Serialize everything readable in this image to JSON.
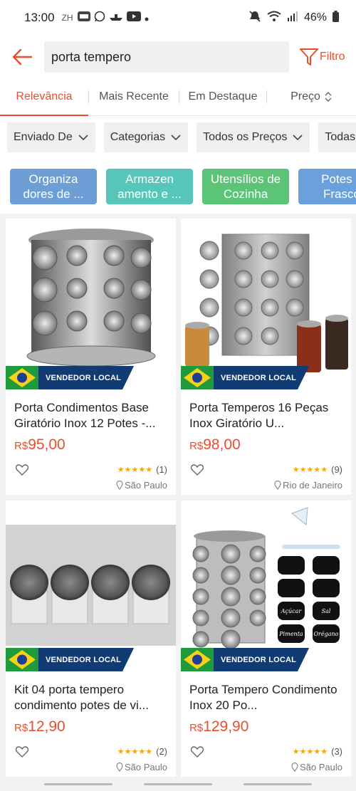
{
  "status_bar": {
    "time": "13:00",
    "lang": "ZH",
    "battery": "46%"
  },
  "search": {
    "query": "porta tempero",
    "filter_label": "Filtro"
  },
  "sort_tabs": [
    {
      "label": "Relevância",
      "active": true
    },
    {
      "label": "Mais Recente",
      "active": false
    },
    {
      "label": "Em Destaque",
      "active": false
    },
    {
      "label": "Preço",
      "active": false
    }
  ],
  "filters": [
    "Enviado De",
    "Categorias",
    "Todos os Preços",
    "Todas Es"
  ],
  "categories": [
    {
      "label": "Organiza dores de ...",
      "color": "#6d9fd6"
    },
    {
      "label": "Armazen amento e ...",
      "color": "#55c6b9"
    },
    {
      "label": "Utensílios de Cozinha",
      "color": "#5bc477"
    },
    {
      "label": "Potes e Frasco",
      "color": "#6aa0dc"
    }
  ],
  "badge_label": "VENDEDOR LOCAL",
  "products": [
    {
      "name": "Porta Condimentos Base Giratório Inox 12 Potes -...",
      "currency": "R$",
      "price": "95,00",
      "reviews": "(1)",
      "location": "São Paulo",
      "image": "round-rack"
    },
    {
      "name": "Porta Temperos 16 Peças Inox Giratório U...",
      "currency": "R$",
      "price": "98,00",
      "reviews": "(9)",
      "location": "Rio de Janeiro",
      "image": "square-rack"
    },
    {
      "name": "Kit 04 porta tempero condimento potes de vi...",
      "currency": "R$",
      "price": "12,90",
      "reviews": "(2)",
      "location": "São Paulo",
      "image": "jars-row"
    },
    {
      "name": "Porta Tempero Condimento Inox 20 Po...",
      "currency": "R$",
      "price": "129,90",
      "reviews": "(3)",
      "location": "São Paulo",
      "image": "rack-labels"
    }
  ],
  "label_words": [
    "Açúcar",
    "Sal",
    "Pimenta",
    "Orégano"
  ],
  "colors": {
    "accent": "#ee4d2d",
    "badge_bg": "#113b73",
    "flag_green": "#1f9a3c",
    "star": "#f6a700"
  }
}
